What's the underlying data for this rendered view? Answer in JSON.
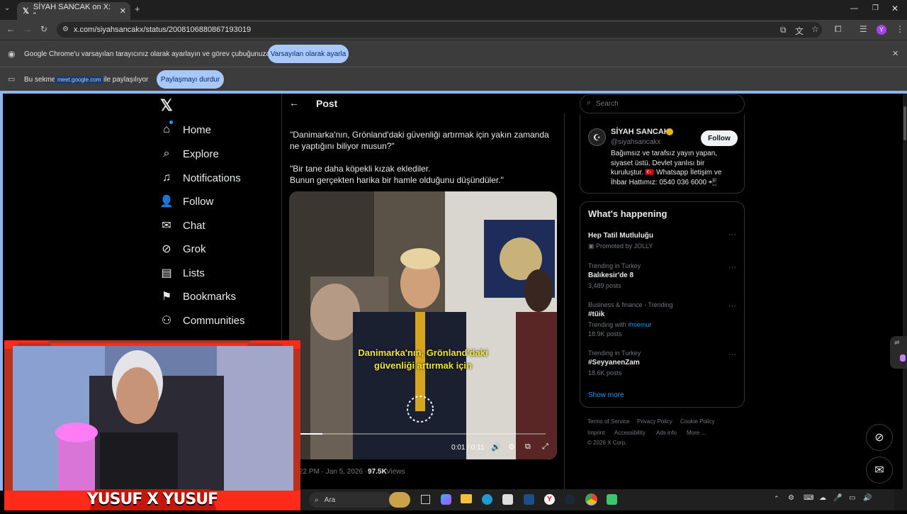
{
  "browser": {
    "tab_title": "SİYAH SANCAK on X: \"",
    "url": "x.com/siyahsancakx/status/2008106880867193019",
    "infobar1_text": "Google Chrome'u varsayılan tarayıcınız olarak ayarlayın ve görev çubuğunuza sabitleyin",
    "infobar1_button": "Varsayılan olarak ayarla",
    "infobar2_prefix": "Bu sekme",
    "infobar2_chip": "meet.google.com",
    "infobar2_suffix": "ile paylaşılıyor",
    "infobar2_button": "Paylaşmayı durdur",
    "profile_initial": "Y"
  },
  "nav": {
    "items": [
      {
        "label": "Home",
        "icon": "home-icon"
      },
      {
        "label": "Explore",
        "icon": "search-icon"
      },
      {
        "label": "Notifications",
        "icon": "bell-icon"
      },
      {
        "label": "Follow",
        "icon": "follow-icon"
      },
      {
        "label": "Chat",
        "icon": "mail-icon"
      },
      {
        "label": "Grok",
        "icon": "grok-icon"
      },
      {
        "label": "Lists",
        "icon": "list-icon"
      },
      {
        "label": "Bookmarks",
        "icon": "bookmark-icon"
      },
      {
        "label": "Communities",
        "icon": "communities-icon"
      }
    ]
  },
  "post": {
    "header": "Post",
    "text1": "\"Danimarka'nın, Grönland'daki güvenliği artırmak için yakın zamanda ne yaptığını biliyor musun?\"",
    "text2_line1": "\"Bir tane daha köpekli kızak eklediler.",
    "text2_line2": "Bunun gerçekten harika bir hamle olduğunu düşündüler.\"",
    "subtitle_line1": "Danimarka'nın, Grönland'daki",
    "subtitle_line2": "güvenliği artırmak için",
    "video_time": "0:01 / 0:11",
    "video_progress": 0.09,
    "meta_time": "22 PM · Jan 5, 2026 ·",
    "views_count": "97.5K",
    "views_label": "Views"
  },
  "sidebar": {
    "search_placeholder": "Search",
    "profile": {
      "name": "SİYAH SANCAK",
      "handle": "@siyahsancakx",
      "follow_label": "Follow",
      "bio": "Bağımsız ve tarafsız yayın yapan, siyaset üstü, Devlet yanlısı bir kuruluştur. 🇹🇷 Whatsapp İletişim ve İhbar Hattımız: 0540 036 6000 📲"
    },
    "happening_title": "What's happening",
    "trends": [
      {
        "context": "",
        "name": "Hep Tatil Mutluluğu",
        "extra": "Promoted by JOLLY"
      },
      {
        "context": "Trending in Turkey",
        "name": "Balıkesir'de 8",
        "extra": "3,489 posts"
      },
      {
        "context": "Business & finance · Trending",
        "name": "#tüik",
        "extra": "18.9K posts",
        "with_prefix": "Trending with",
        "with_tag": "#memur"
      },
      {
        "context": "Trending in Turkey",
        "name": "#SeyyanenZam",
        "extra": "18.6K posts"
      }
    ],
    "show_more": "Show more",
    "footer": [
      "Terms of Service",
      "Privacy Policy",
      "Cookie Policy",
      "Imprint",
      "Accessibility",
      "Ads info",
      "More ...",
      "© 2026 X Corp."
    ]
  },
  "webcam": {
    "name_text": "YUSUF X YUSUF"
  },
  "taskbar": {
    "search_placeholder": "Ara"
  }
}
